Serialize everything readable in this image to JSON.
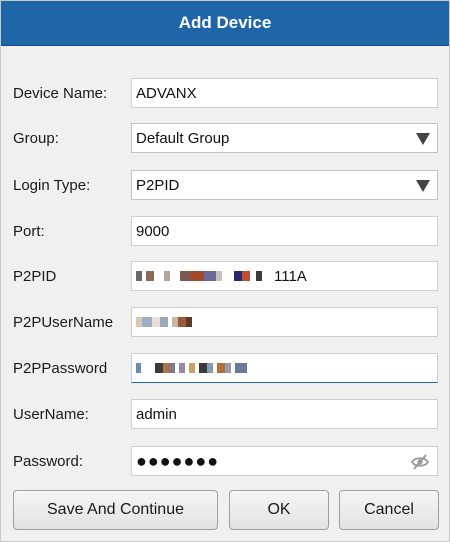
{
  "window": {
    "title": "Add Device"
  },
  "form": {
    "device_name": {
      "label": "Device Name:",
      "value": "ADVANX"
    },
    "group": {
      "label": "Group:",
      "value": "Default Group"
    },
    "login_type": {
      "label": "Login Type:",
      "value": "P2PID"
    },
    "port": {
      "label": "Port:",
      "value": "9000"
    },
    "p2pid": {
      "label": "P2PID",
      "value_suffix": "111A"
    },
    "p2p_username": {
      "label": "P2PUserName"
    },
    "p2p_password": {
      "label": "P2PPassword"
    },
    "username": {
      "label": "UserName:",
      "value": "admin"
    },
    "password": {
      "label": "Password:",
      "value_masked": "●●●●●●●"
    }
  },
  "buttons": {
    "save_and_continue": "Save And Continue",
    "ok": "OK",
    "cancel": "Cancel"
  },
  "icons": {
    "dropdown": "chevron-down-icon",
    "password_toggle": "eye-slash-icon"
  },
  "colors": {
    "titlebar": "#1f66a8",
    "background": "#f0f0f0"
  }
}
